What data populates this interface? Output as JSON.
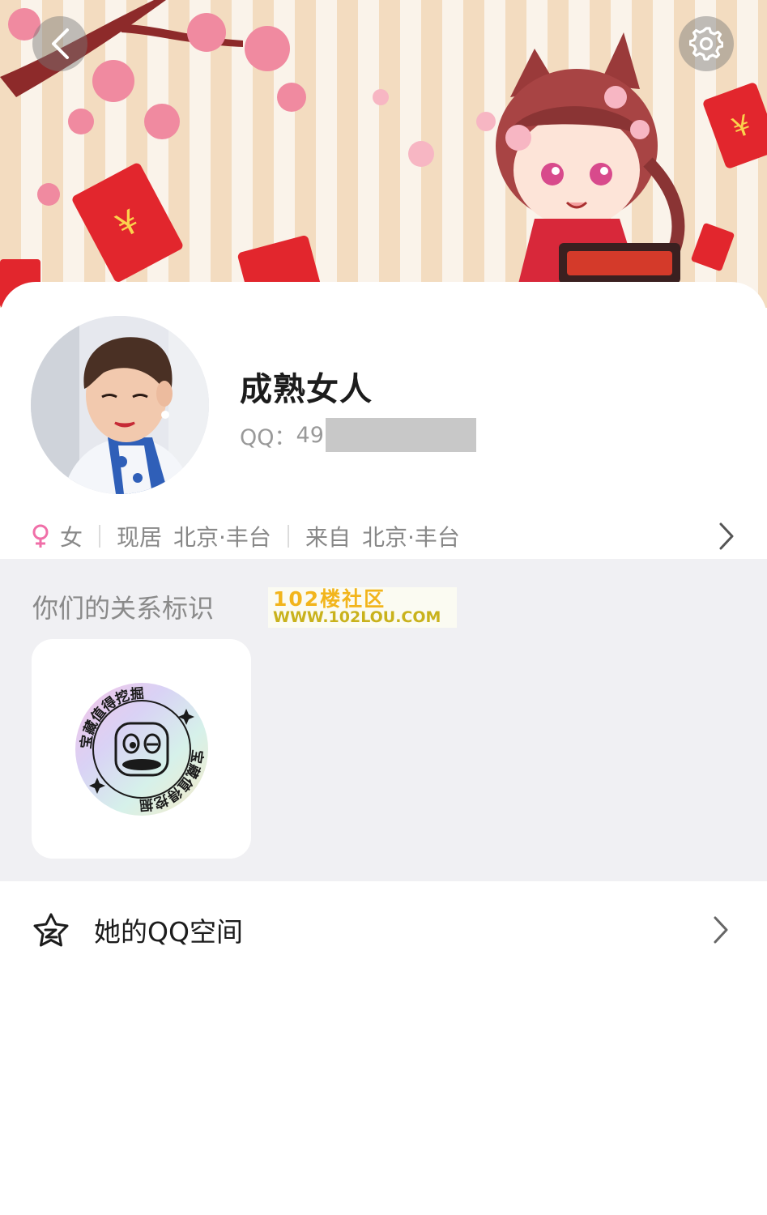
{
  "header": {
    "back_icon": "chevron-left-icon",
    "settings_icon": "gear-icon"
  },
  "profile": {
    "nickname": "成熟女人",
    "qq_label": "QQ：",
    "qq_visible_digits": "49"
  },
  "info": {
    "gender": "女",
    "gender_icon": "female-icon",
    "residence_label": "现居",
    "residence_value": "北京·丰台",
    "hometown_label": "来自",
    "hometown_value": "北京·丰台"
  },
  "relation": {
    "title": "你们的关系标识",
    "badge_text": "宝藏值得挖掘",
    "watermark_line1": "102楼社区",
    "watermark_line2": "WWW.102LOU.COM"
  },
  "qzone": {
    "label": "她的QQ空间",
    "icon": "qzone-star-icon"
  },
  "colors": {
    "female_pink": "#f06fa8",
    "section_bg": "#f0f0f3",
    "watermark_yellow": "#f2b51c"
  }
}
